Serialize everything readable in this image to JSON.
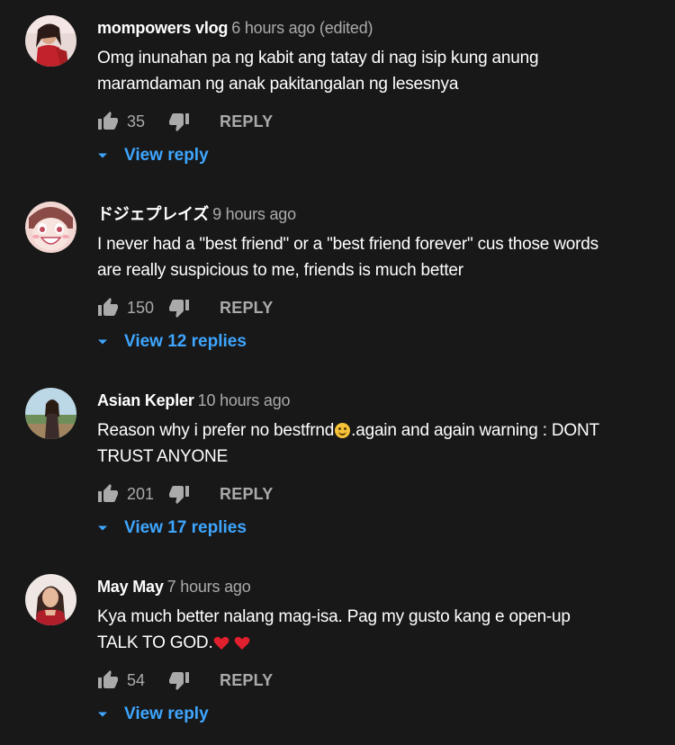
{
  "colors": {
    "background": "#181818",
    "text": "#ffffff",
    "secondary": "#aaaaaa",
    "link": "#3ea6ff"
  },
  "icons": {
    "like": "thumb-up-icon",
    "dislike": "thumb-down-icon",
    "expand": "chevron-down-icon"
  },
  "comments": [
    {
      "author": "mompowers vlog",
      "time": "6 hours ago (edited)",
      "text": "Omg inunahan pa ng kabit ang tatay di nag isip kung anung maramdaman ng anak pakitangalan ng lesesnya",
      "likes": "35",
      "reply_label": "REPLY",
      "view_replies": "View reply"
    },
    {
      "author": "ドジェプレイズ",
      "time": "9 hours ago",
      "text": "I never had a \"best friend\" or a \"best friend forever\" cus those words are really suspicious to me, friends is much better",
      "likes": "150",
      "reply_label": "REPLY",
      "view_replies": "View 12 replies"
    },
    {
      "author": "Asian Kepler",
      "time": "10 hours ago",
      "text_before_emoji": "Reason why i prefer no bestfrnd",
      "text_after_emoji": ".again and again  warning : DONT TRUST ANYONE",
      "likes": "201",
      "reply_label": "REPLY",
      "view_replies": "View 17 replies"
    },
    {
      "author": "May May",
      "time": "7 hours ago",
      "text": "Kya much better nalang mag-isa.  Pag my gusto kang e open-up  TALK TO GOD.",
      "likes": "54",
      "reply_label": "REPLY",
      "view_replies": "View reply"
    }
  ]
}
